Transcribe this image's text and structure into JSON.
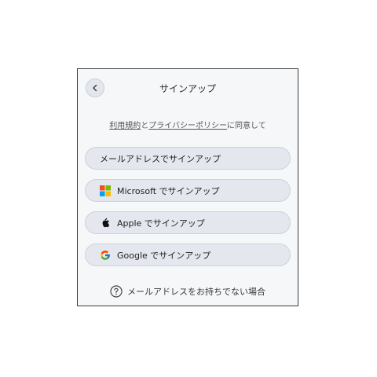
{
  "header": {
    "title": "サインアップ",
    "back_icon": "chevron-left-icon"
  },
  "consent": {
    "terms_link": "利用規約",
    "and_text": "と",
    "privacy_link": "プライバシーポリシー",
    "agree_text": "に同意して"
  },
  "options": [
    {
      "label": "メールアドレスでサインアップ",
      "icon": "none"
    },
    {
      "label": "Microsoft でサインアップ",
      "icon": "microsoft-logo-icon"
    },
    {
      "label": "Apple でサインアップ",
      "icon": "apple-logo-icon"
    },
    {
      "label": "Google でサインアップ",
      "icon": "google-logo-icon"
    }
  ],
  "help": {
    "label": "メールアドレスをお持ちでない場合",
    "icon": "question-circle-icon"
  },
  "colors": {
    "button_bg": "#e4e7ee",
    "card_bg": "#f6f7f9"
  }
}
